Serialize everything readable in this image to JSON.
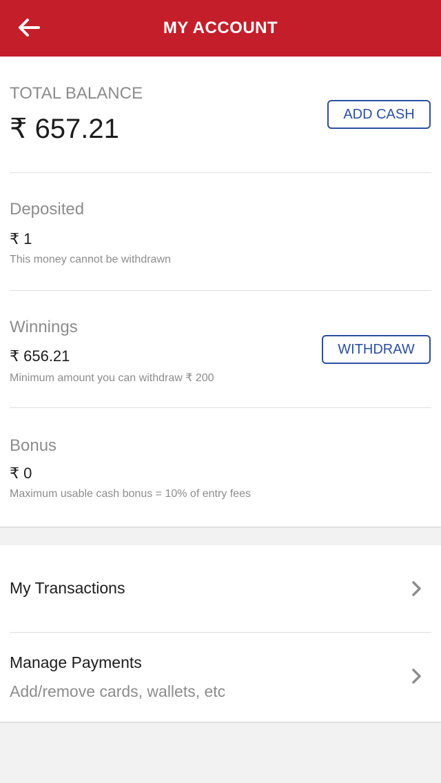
{
  "header": {
    "title": "MY ACCOUNT",
    "back_icon": "arrow-left-icon",
    "background_color": "#c41e2a"
  },
  "balance": {
    "total_label": "TOTAL BALANCE",
    "total_amount": "₹ 657.21",
    "add_cash_label": "ADD CASH"
  },
  "deposited": {
    "label": "Deposited",
    "amount": "₹ 1",
    "note": "This money cannot be withdrawn"
  },
  "winnings": {
    "label": "Winnings",
    "amount": "₹ 656.21",
    "note": "Minimum amount you can withdraw ₹ 200",
    "withdraw_label": "WITHDRAW"
  },
  "bonus": {
    "label": "Bonus",
    "amount": "₹ 0",
    "note": "Maximum usable cash bonus = 10% of entry fees"
  },
  "links": {
    "transactions": {
      "title": "My Transactions",
      "icon": "chevron-right-icon"
    },
    "payments": {
      "title": "Manage Payments",
      "subtitle": "Add/remove cards, wallets, etc",
      "icon": "chevron-right-icon"
    }
  },
  "colors": {
    "accent_button": "#2a4fa0",
    "muted_text": "#8c8c8c"
  }
}
